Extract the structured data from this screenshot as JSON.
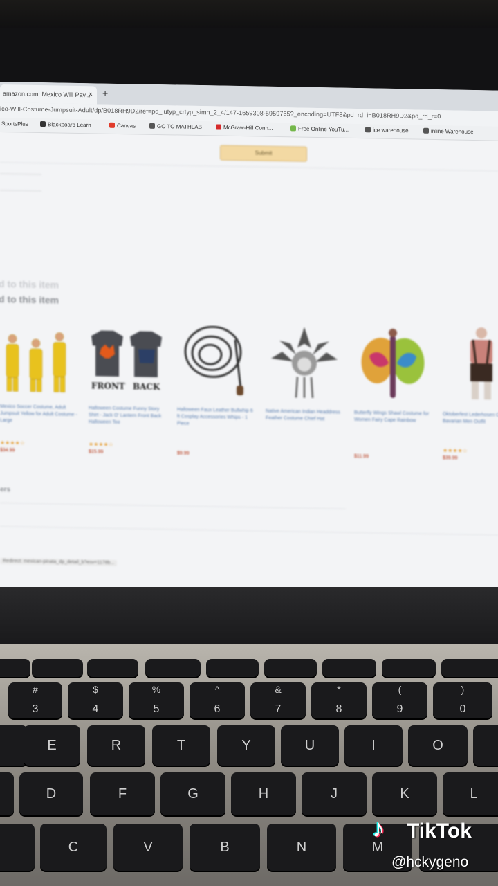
{
  "browser": {
    "tab_title": "amazon.com: Mexico Will Pay...",
    "tab_close": "×",
    "new_tab": "+",
    "url": "ico-Will-Costume-Jumpsuit-Adult/dp/B018RH9D2/ref=pd_lutyp_crtyp_simh_2_4/147-1659308-5959765?_encoding=UTF8&pd_rd_i=B018RH9D2&pd_rd_r=0",
    "bookmarks": [
      {
        "label": "SportsPlus",
        "color": "#9aa0a6"
      },
      {
        "label": "Blackboard Learn",
        "color": "#333333"
      },
      {
        "label": "Canvas",
        "color": "#e13b2b"
      },
      {
        "label": "GO TO MATHLAB",
        "color": "#555555"
      },
      {
        "label": "McGraw-Hill Conn...",
        "color": "#d62b2b"
      },
      {
        "label": "Free Online YouTu...",
        "color": "#74b74a"
      },
      {
        "label": "ice warehouse",
        "color": "#555555"
      },
      {
        "label": "inline Warehouse",
        "color": "#555555"
      }
    ]
  },
  "page": {
    "submit_label": "Submit",
    "heading_faint": "d to this item",
    "heading": "d to this item",
    "section_label": "ers",
    "status_url": "Redirect: mexican-pinata_dp_detail_b?esv=1178b..."
  },
  "products": [
    {
      "title": "Mexico Soccer Costume, Adult Jumpsuit Yellow for Adult Costume - Large",
      "stars": "★★★★☆",
      "price": "$34.99"
    },
    {
      "title": "Halloween Costume Funny Story Shirt - Jack O' Lantern Front Back Halloween Tee",
      "stars": "★★★★☆",
      "price": "$15.99"
    },
    {
      "title": "Halloween Faux Leather Bullwhip 6 ft Cosplay Accessories Whips - 1 Piece",
      "stars": "",
      "price": "$9.99"
    },
    {
      "title": "Native American Indian Headdress Feather Costume Chief Hat",
      "stars": "",
      "price": ""
    },
    {
      "title": "Butterfly Wings Shawl Costume for Women Fairy Cape Rainbow",
      "stars": "",
      "price": "$11.99"
    },
    {
      "title": "Oktoberfest Lederhosen Costume Bavarian Men Outfit",
      "stars": "★★★★☆",
      "price": "$39.99"
    }
  ],
  "colors": {
    "submit_bg": "#f3d9a3",
    "link": "#5b7fb0",
    "star": "#e6a23c",
    "price": "#b12704",
    "costume_yellow": "#e8c21e"
  },
  "keyboard": {
    "row1": [
      {
        "top": "#",
        "bottom": "3"
      },
      {
        "top": "$",
        "bottom": "4"
      },
      {
        "top": "%",
        "bottom": "5"
      },
      {
        "top": "^",
        "bottom": "6"
      },
      {
        "top": "&",
        "bottom": "7"
      },
      {
        "top": "*",
        "bottom": "8"
      },
      {
        "top": "(",
        "bottom": "9"
      },
      {
        "top": ")",
        "bottom": "0"
      }
    ],
    "row2": [
      "E",
      "R",
      "T",
      "Y",
      "U",
      "I",
      "O"
    ],
    "row3": [
      "D",
      "F",
      "G",
      "H",
      "J",
      "K",
      "L"
    ],
    "row4": [
      "C",
      "V",
      "B",
      "N",
      "M"
    ]
  },
  "overlay": {
    "brand": "TikTok",
    "handle": "@hckygeno"
  }
}
